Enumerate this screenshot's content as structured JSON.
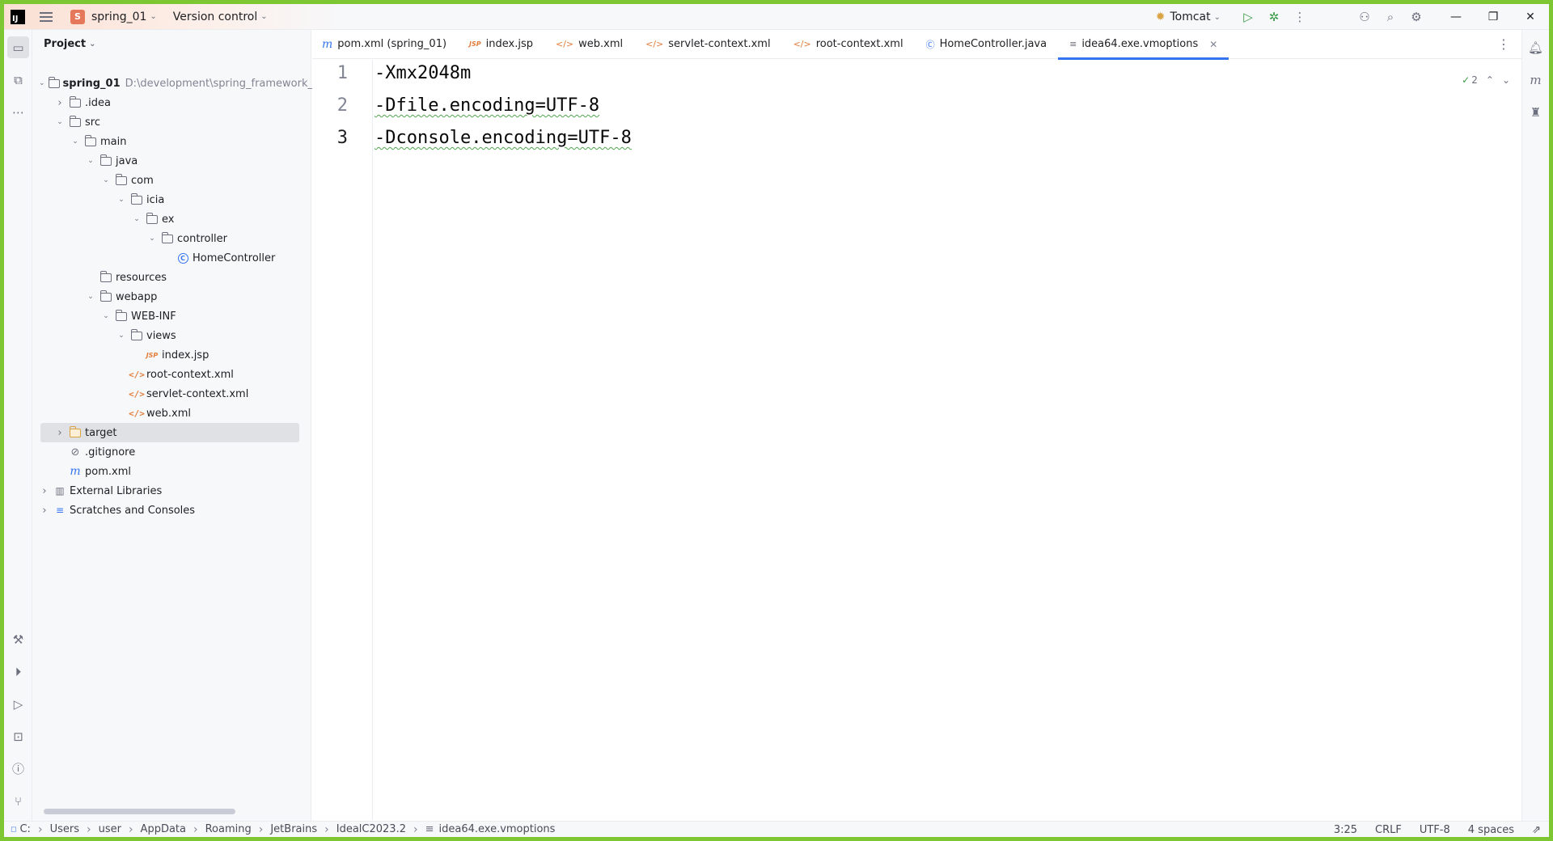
{
  "titlebar": {
    "project_badge": "S",
    "project_name": "spring_01",
    "vcs": "Version control",
    "run_config": "Tomcat"
  },
  "project_panel": {
    "title": "Project",
    "root_path": "D:\\development\\spring_framework_c",
    "tree": [
      {
        "label": "spring_01",
        "depth": 0,
        "arrow": "open",
        "icon": "module-folder"
      },
      {
        "label": ".idea",
        "depth": 1,
        "arrow": "closed",
        "icon": "folder"
      },
      {
        "label": "src",
        "depth": 1,
        "arrow": "open",
        "icon": "folder"
      },
      {
        "label": "main",
        "depth": 2,
        "arrow": "open",
        "icon": "folder"
      },
      {
        "label": "java",
        "depth": 3,
        "arrow": "open",
        "icon": "source-folder"
      },
      {
        "label": "com",
        "depth": 4,
        "arrow": "open",
        "icon": "package"
      },
      {
        "label": "icia",
        "depth": 5,
        "arrow": "open",
        "icon": "package"
      },
      {
        "label": "ex",
        "depth": 6,
        "arrow": "open",
        "icon": "package"
      },
      {
        "label": "controller",
        "depth": 7,
        "arrow": "open",
        "icon": "package"
      },
      {
        "label": "HomeController",
        "depth": 8,
        "arrow": "none",
        "icon": "class"
      },
      {
        "label": "resources",
        "depth": 3,
        "arrow": "none",
        "icon": "resources-folder"
      },
      {
        "label": "webapp",
        "depth": 3,
        "arrow": "open",
        "icon": "folder"
      },
      {
        "label": "WEB-INF",
        "depth": 4,
        "arrow": "open",
        "icon": "folder"
      },
      {
        "label": "views",
        "depth": 5,
        "arrow": "open",
        "icon": "folder"
      },
      {
        "label": "index.jsp",
        "depth": 6,
        "arrow": "none",
        "icon": "jsp"
      },
      {
        "label": "root-context.xml",
        "depth": 5,
        "arrow": "none",
        "icon": "xml"
      },
      {
        "label": "servlet-context.xml",
        "depth": 5,
        "arrow": "none",
        "icon": "xml"
      },
      {
        "label": "web.xml",
        "depth": 5,
        "arrow": "none",
        "icon": "xml"
      },
      {
        "label": "target",
        "depth": 1,
        "arrow": "closed",
        "icon": "excluded-folder",
        "selected": true
      },
      {
        "label": ".gitignore",
        "depth": 1,
        "arrow": "none",
        "icon": "ignore"
      },
      {
        "label": "pom.xml",
        "depth": 1,
        "arrow": "none",
        "icon": "maven"
      },
      {
        "label": "External Libraries",
        "depth": 0,
        "arrow": "closed",
        "icon": "library"
      },
      {
        "label": "Scratches and Consoles",
        "depth": 0,
        "arrow": "closed",
        "icon": "scratches"
      }
    ]
  },
  "tabs": [
    {
      "label": "pom.xml (spring_01)",
      "icon": "maven"
    },
    {
      "label": "index.jsp",
      "icon": "jsp"
    },
    {
      "label": "web.xml",
      "icon": "xml"
    },
    {
      "label": "servlet-context.xml",
      "icon": "xml"
    },
    {
      "label": "root-context.xml",
      "icon": "xml"
    },
    {
      "label": "HomeController.java",
      "icon": "class"
    },
    {
      "label": "idea64.exe.vmoptions",
      "icon": "text",
      "active": true
    }
  ],
  "editor": {
    "lines": [
      {
        "num": "1",
        "text": "-Xmx2048m"
      },
      {
        "num": "2",
        "text": "-Dfile.encoding=UTF-8"
      },
      {
        "num": "3",
        "text": "-Dconsole.encoding=UTF-8"
      }
    ],
    "inspection_count": "2"
  },
  "statusbar": {
    "breadcrumbs": [
      "C:",
      "Users",
      "user",
      "AppData",
      "Roaming",
      "JetBrains",
      "IdealC2023.2",
      "idea64.exe.vmoptions"
    ],
    "position": "3:25",
    "line_sep": "CRLF",
    "encoding": "UTF-8",
    "indent": "4 spaces"
  }
}
